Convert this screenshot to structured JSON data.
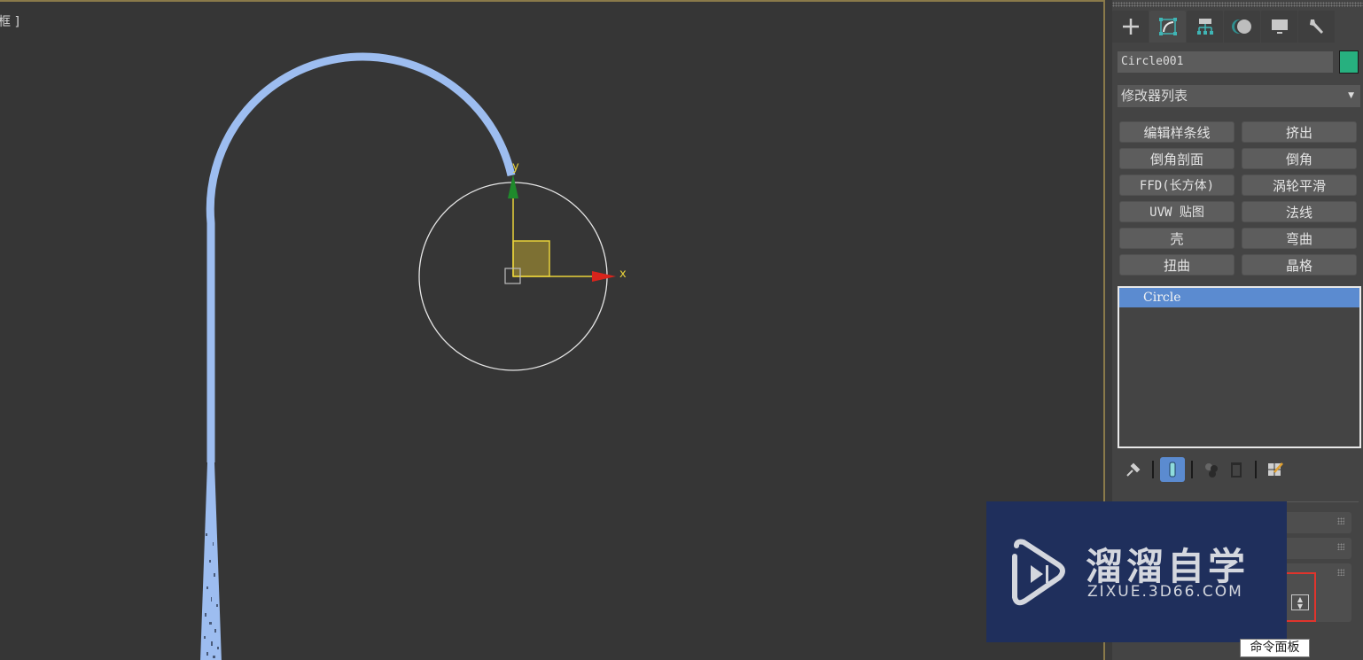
{
  "viewport": {
    "label": "框 ]",
    "gizmo": {
      "x_axis_label": "x",
      "y_axis_label": "y"
    },
    "colors": {
      "spline": "#9dbdf0",
      "circle": "#e6e6e6",
      "gizmo_axis": "#e8d23a",
      "x_arrow": "#d8241c",
      "y_arrow": "#1f8a2c",
      "plane": "#7d7033"
    }
  },
  "command_panel": {
    "tabs": [
      {
        "name": "create",
        "icon": "plus-icon",
        "active": false
      },
      {
        "name": "modify",
        "icon": "modify-curve-icon",
        "active": true
      },
      {
        "name": "hierarchy",
        "icon": "hierarchy-icon",
        "active": false
      },
      {
        "name": "motion",
        "icon": "motion-icon",
        "active": false
      },
      {
        "name": "display",
        "icon": "display-monitor-icon",
        "active": false
      },
      {
        "name": "utilities",
        "icon": "wrench-icon",
        "active": false
      }
    ],
    "object_name": "Circle001",
    "object_color": "#27b07f",
    "modifier_list_label": "修改器列表",
    "modifier_buttons": [
      "编辑样条线",
      "挤出",
      "倒角剖面",
      "倒角",
      "FFD(长方体)",
      "涡轮平滑",
      "UVW 贴图",
      "法线",
      "壳",
      "弯曲",
      "扭曲",
      "晶格"
    ],
    "stack_items": [
      {
        "label": "Circle",
        "selected": true
      }
    ],
    "stack_tools": [
      "pin-stack-icon",
      "show-end-result-icon",
      "make-unique-icon",
      "remove-modifier-icon",
      "configure-modifier-sets-icon"
    ],
    "tooltip": "命令面板"
  },
  "watermark": {
    "title": "溜溜自学",
    "subtitle": "ZIXUE.3D66.COM"
  }
}
